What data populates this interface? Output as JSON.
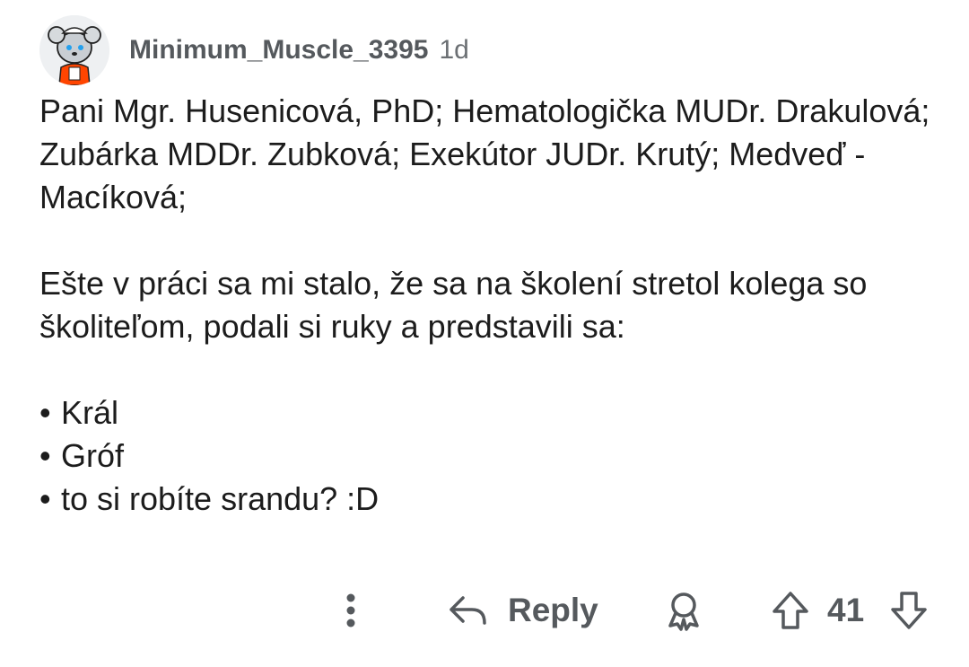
{
  "comment": {
    "author": "Minimum_Muscle_3395",
    "age": "1d",
    "paragraphs": [
      "Pani Mgr. Husenicová, PhD; Hematologička MUDr. Drakulová; Zubárka MDDr. Zubková; Exekútor JUDr. Krutý; Medveď -Macíková;",
      "Ešte v práci sa mi stalo, že sa na školení stretol kolega so školiteľom, podali si ruky a predstavili sa:"
    ],
    "bullets": [
      "Král",
      "Gróf",
      "to si robíte srandu? :D"
    ]
  },
  "actions": {
    "more_icon": "more-vertical-icon",
    "reply_icon": "reply-arrow-icon",
    "reply_label": "Reply",
    "award_icon": "award-icon",
    "upvote_icon": "upvote-arrow-icon",
    "score": "41",
    "downvote_icon": "downvote-arrow-icon"
  },
  "colors": {
    "text": "#1c1c1c",
    "muted": "#55595d",
    "background": "#ffffff",
    "avatar_bg": "#eef0f2",
    "avatar_accent": "#ff4500"
  }
}
